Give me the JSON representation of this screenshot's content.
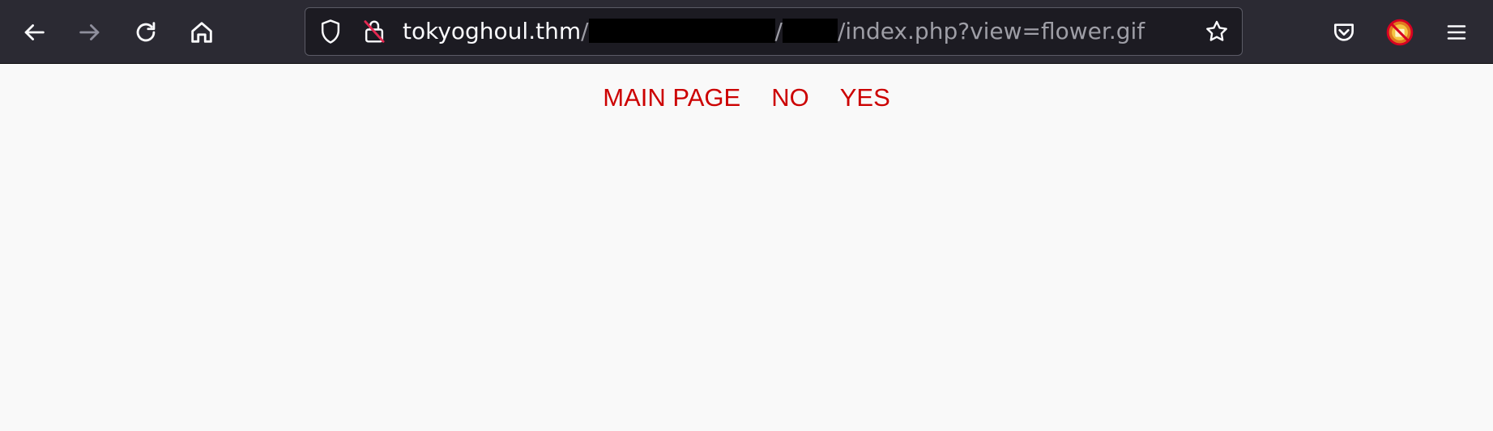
{
  "browser": {
    "url": {
      "host": "tokyoghoul.thm",
      "sep1": "/",
      "sep2": "/",
      "path_tail": "/index.php?view=flower.gif"
    },
    "icons": {
      "back": "back-arrow-icon",
      "forward": "forward-arrow-icon",
      "reload": "reload-icon",
      "home": "home-icon",
      "shield": "tracking-protection-shield-icon",
      "insecure_lock": "insecure-lock-icon",
      "bookmark": "bookmark-star-icon",
      "pocket": "pocket-icon",
      "extension": "extension-icon",
      "menu": "hamburger-menu-icon"
    },
    "colors": {
      "toolbar": "#2b2a33",
      "urlbar": "#1c1b22",
      "icon": "#fbfbfe"
    }
  },
  "page": {
    "nav": [
      {
        "label": "MAIN PAGE"
      },
      {
        "label": "NO"
      },
      {
        "label": "YES"
      }
    ],
    "colors": {
      "link": "#cc0000",
      "background": "#f9f9f9"
    }
  }
}
